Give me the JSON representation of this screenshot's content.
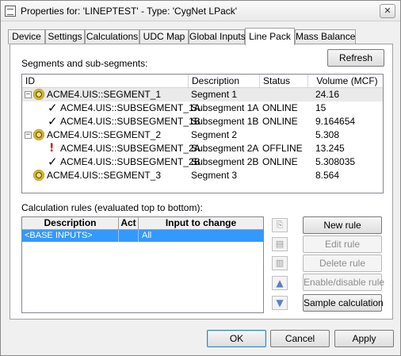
{
  "window": {
    "title": "Properties for: 'LINEPTEST' - Type: 'CygNet LPack'",
    "close_symbol": "✕"
  },
  "tabs": [
    {
      "label": "Device"
    },
    {
      "label": "Settings"
    },
    {
      "label": "Calculations"
    },
    {
      "label": "UDC Map"
    },
    {
      "label": "Global Inputs"
    },
    {
      "label": "Line Pack"
    },
    {
      "label": "Mass Balance"
    }
  ],
  "active_tab": "Line Pack",
  "segments": {
    "section_label": "Segments and sub-segments:",
    "refresh_label": "Refresh",
    "columns": [
      "ID",
      "Description",
      "Status",
      "Volume (MCF)"
    ],
    "rows": [
      {
        "id": "ACME4.UIS::SEGMENT_1",
        "description": "Segment 1",
        "status": "",
        "volume": "24.16",
        "expander": "−",
        "icon": "gear-icon",
        "level": 0,
        "selected": true
      },
      {
        "id": "ACME4.UIS::SUBSEGMENT_1A",
        "description": "Subsegment 1A",
        "status": "ONLINE",
        "volume": "15",
        "icon": "check-icon",
        "level": 1
      },
      {
        "id": "ACME4.UIS::SUBSEGMENT_1B",
        "description": "Subsegment 1B",
        "status": "ONLINE",
        "volume": "9.164654",
        "icon": "check-icon",
        "level": 1
      },
      {
        "id": "ACME4.UIS::SEGMENT_2",
        "description": "Segment 2",
        "status": "",
        "volume": "5.308",
        "expander": "−",
        "icon": "gear-icon",
        "level": 0
      },
      {
        "id": "ACME4.UIS::SUBSEGMENT_2A",
        "description": "Subsegment 2A",
        "status": "OFFLINE",
        "volume": "13.245",
        "icon": "error-icon",
        "level": 1
      },
      {
        "id": "ACME4.UIS::SUBSEGMENT_2B",
        "description": "Subsegment 2B",
        "status": "ONLINE",
        "volume": "5.308035",
        "icon": "check-icon",
        "level": 1
      },
      {
        "id": "ACME4.UIS::SEGMENT_3",
        "description": "Segment 3",
        "status": "",
        "volume": "8.564",
        "icon": "gear-icon",
        "level": 0
      }
    ]
  },
  "rules": {
    "section_label": "Calculation rules (evaluated top to bottom):",
    "columns": [
      "Description",
      "Act",
      "Input to change"
    ],
    "rows": [
      {
        "description": "<BASE INPUTS>",
        "act": "",
        "input": "All"
      }
    ],
    "buttons": {
      "new_rule": "New rule",
      "edit_rule": "Edit rule",
      "delete_rule": "Delete rule",
      "enable_disable_rule": "Enable/disable rule",
      "sample_calculation": "Sample calculation"
    },
    "side_icons": [
      "copy-icon",
      "paste-icon",
      "paste-special-icon",
      "move-up-icon",
      "move-down-icon"
    ]
  },
  "footer": {
    "ok_label": "OK",
    "cancel_label": "Cancel",
    "apply_label": "Apply"
  }
}
